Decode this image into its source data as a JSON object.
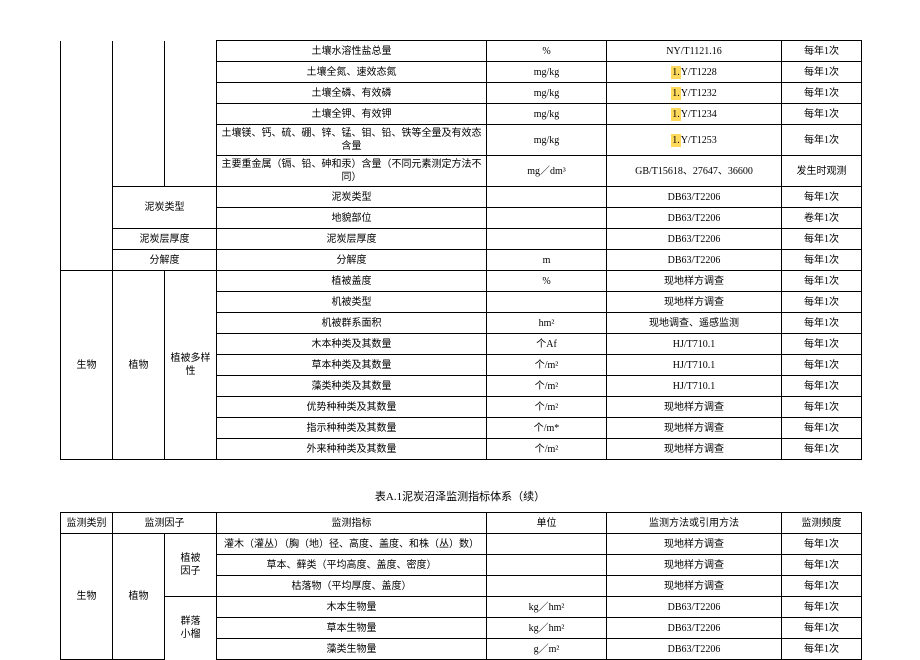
{
  "table1": {
    "rows": [
      {
        "c4": "土壤水溶性盐总量",
        "c5": "%",
        "c6": "NY/T1121.16",
        "c7": "每年1次",
        "hl": false
      },
      {
        "c4": "土壤全氮、速效态氮",
        "c5": "mg/kg",
        "c6p": "1.",
        "c6": "Y/T1228",
        "c7": "每年1次",
        "hl": true
      },
      {
        "c4": "土壤全磷、有效磷",
        "c5": "mg/kg",
        "c6p": "1.",
        "c6": "Y/T1232",
        "c7": "每年1次",
        "hl": true
      },
      {
        "c4": "土壤全钾、有效钾",
        "c5": "mg/kg",
        "c6p": "1.",
        "c6": "Y/T1234",
        "c7": "每年1次",
        "hl": true
      },
      {
        "c4": "土壤镁、钙、硫、硼、锌、锰、钼、铅、铁等全量及有效态含量",
        "c5": "mg/kg",
        "c6p": "1.",
        "c6": "Y/T1253",
        "c7": "每年1次",
        "hl": true
      },
      {
        "c4": "主要重金属（镉、铅、砷和汞）含量（不同元素测定方法不同）",
        "c5": "mg／dm³",
        "c6": "GB/T15618、27647、36600",
        "c7": "发生时观测",
        "hl": false
      }
    ],
    "peat": {
      "label": "泥炭类型",
      "r": [
        {
          "c4": "泥炭类型",
          "c5": "",
          "c6": "DB63/T2206",
          "c7": "每年1次"
        },
        {
          "c4": "地貌部位",
          "c5": "",
          "c6": "DB63/T2206",
          "c7": "卷年1次"
        }
      ]
    },
    "thick": {
      "label": "泥炭层厚度",
      "c4": "泥炭层厚度",
      "c5": "",
      "c6": "DB63/T2206",
      "c7": "每年1次"
    },
    "decomp": {
      "label": "分解度",
      "c4": "分解度",
      "c5": "m",
      "c6": "DB63/T2206",
      "c7": "每年1次"
    },
    "bio": {
      "cat": "生物",
      "sub": "植物",
      "div": "植被多样性",
      "rows": [
        {
          "c4": "植被盖度",
          "c5": "%",
          "c6": "现地样方调查",
          "c7": "每年1次"
        },
        {
          "c4": "机被类型",
          "c5": "",
          "c6": "现地样方调查",
          "c7": "每年1次"
        },
        {
          "c4": "机被群系面积",
          "c5": "hm²",
          "c6": "现地调查、遥感监测",
          "c7": "每年1次"
        },
        {
          "c4": "木本种类及其数量",
          "c5": "个Af",
          "c6": "HJ/T710.1",
          "c7": "每年1次"
        },
        {
          "c4": "草本种类及其数量",
          "c5": "个/m²",
          "c6": "HJ/T710.1",
          "c7": "每年1次"
        },
        {
          "c4": "藻类种类及其数量",
          "c5": "个/m²",
          "c6": "HJ/T710.1",
          "c7": "每年1次"
        },
        {
          "c4": "优势种种类及其数量",
          "c5": "个/m²",
          "c6": "现地样方调查",
          "c7": "每年1次"
        },
        {
          "c4": "指示种种类及其数量",
          "c5": "个/m*",
          "c6": "现地样方调查",
          "c7": "每年1次"
        },
        {
          "c4": "外来种种类及其数量",
          "c5": "个/m²",
          "c6": "现地样方调查",
          "c7": "每年1次"
        }
      ]
    }
  },
  "title": "表A.1泥炭沼泽监测指标体系（续）",
  "table2": {
    "header": {
      "c1": "监测类别",
      "c2": "监测因子",
      "c4": "监测指标",
      "c5": "单位",
      "c6": "监测方法或引用方法",
      "c7": "监测频度"
    },
    "cat": "生物",
    "sub": "植物",
    "g1": {
      "label": "植被\n因子",
      "rows": [
        {
          "c4": "灌木（灌丛）（胸（地）径、高度、盖度、和株（丛）数）",
          "c5": "",
          "c6": "现地样方调查",
          "c7": "每年1次"
        },
        {
          "c4": "草本、藓类（平均高度、盖度、密度）",
          "c5": "",
          "c6": "现地样方调查",
          "c7": "每年1次"
        },
        {
          "c4": "枯落物（平均厚度、盖度）",
          "c5": "",
          "c6": "现地样方调查",
          "c7": "每年1次"
        }
      ]
    },
    "g2": {
      "label": "群落\n小榴",
      "rows": [
        {
          "c4": "木本生物量",
          "c5": "kg／hm²",
          "c6": "DB63/T2206",
          "c7": "每年1次"
        },
        {
          "c4": "草本生物量",
          "c5": "kg／hm²",
          "c6": "DB63/T2206",
          "c7": "每年1次"
        },
        {
          "c4": "藻类生物量",
          "c5": "g／m²",
          "c6": "DB63/T2206",
          "c7": "每年1次"
        }
      ]
    }
  }
}
